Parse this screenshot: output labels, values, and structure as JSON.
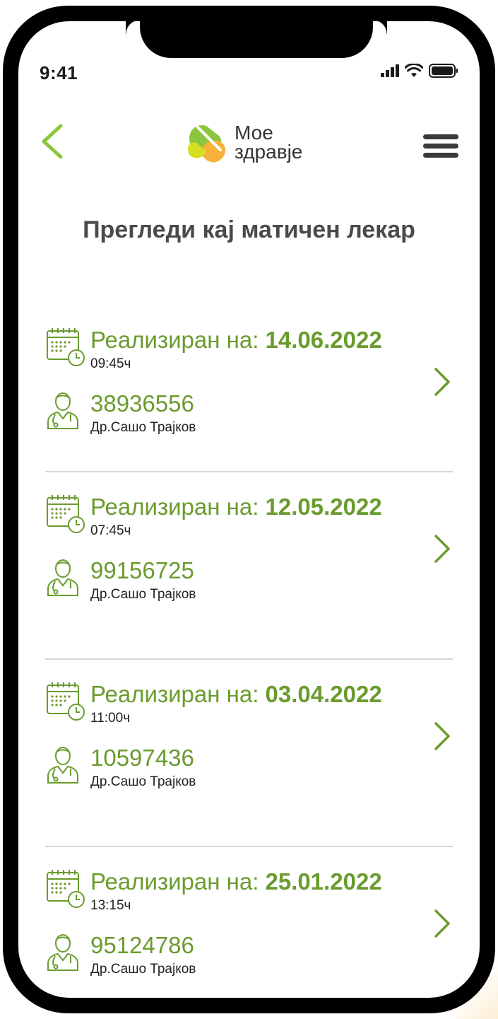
{
  "status_bar": {
    "time": "9:41",
    "icons": [
      "signal-bars-icon",
      "wifi-icon",
      "battery-icon"
    ]
  },
  "header": {
    "back_icon": "chevron-left-icon",
    "logo": {
      "line1": "Мое",
      "line2": "здравје"
    },
    "menu_icon": "hamburger-menu-icon"
  },
  "page": {
    "title": "Прегледи кај матичен лекар"
  },
  "visits": [
    {
      "date_label": "Реализиран на:",
      "date": "14.06.2022",
      "time": "09:45ч",
      "id": "38936556",
      "doctor": "Др.Сашо Трајков"
    },
    {
      "date_label": "Реализиран на:",
      "date": "12.05.2022",
      "time": "07:45ч",
      "id": "99156725",
      "doctor": "Др.Сашо Трајков"
    },
    {
      "date_label": "Реализиран на:",
      "date": "03.04.2022",
      "time": "11:00ч",
      "id": "10597436",
      "doctor": "Др.Сашо Трајков"
    },
    {
      "date_label": "Реализиран на:",
      "date": "25.01.2022",
      "time": "13:15ч",
      "id": "95124786",
      "doctor": "Др.Сашо Трајков"
    }
  ],
  "colors": {
    "accent_green": "#6a9b2e",
    "logo_green": "#8cc63f",
    "logo_yellow": "#f6b23a",
    "text_dark": "#4a4a4a",
    "divider": "#d6d6d6"
  }
}
